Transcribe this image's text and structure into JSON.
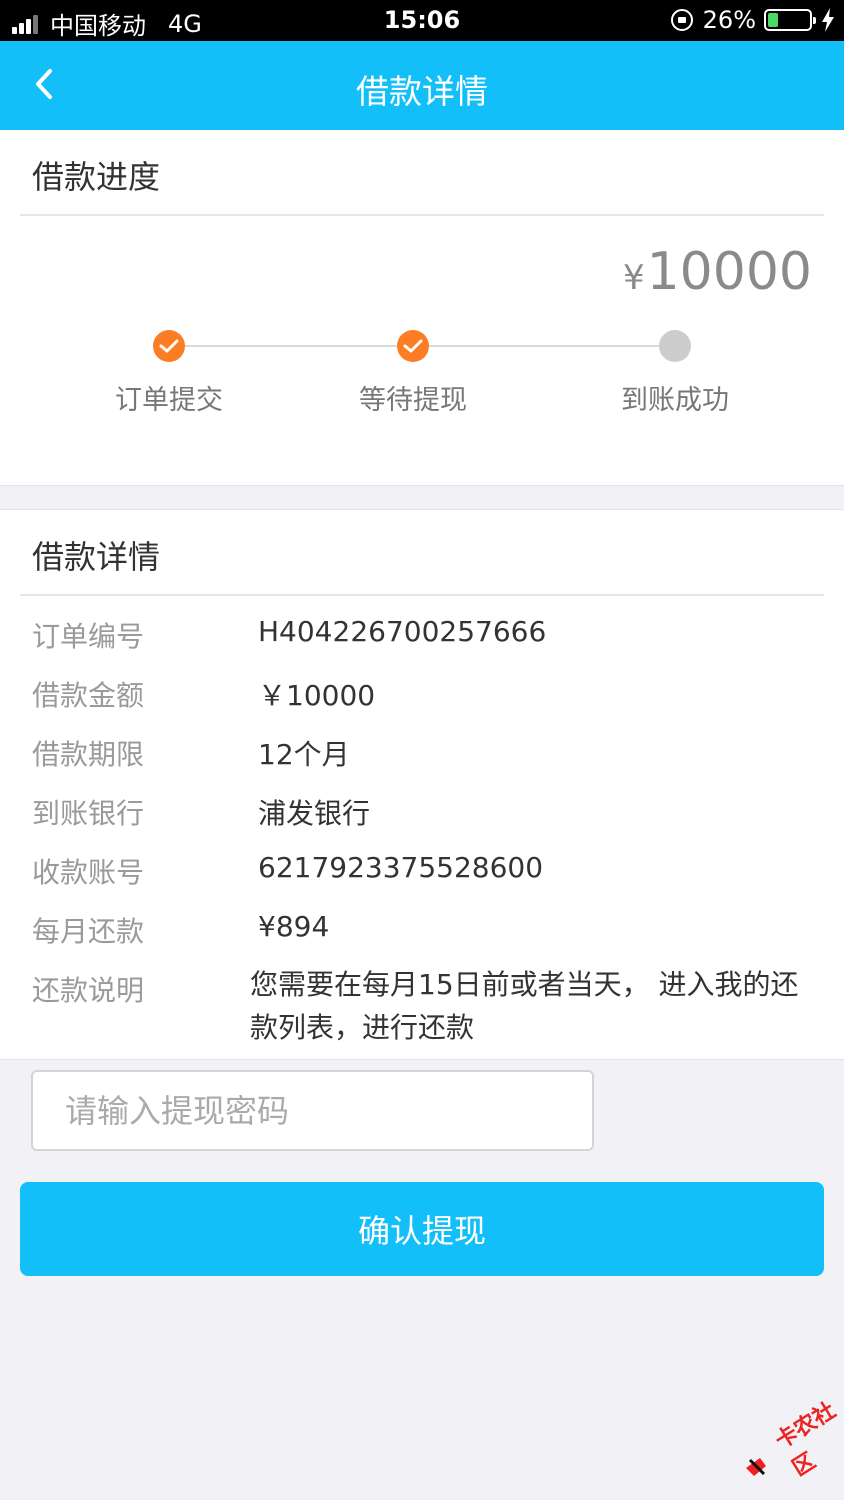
{
  "status_bar": {
    "carrier": "中国移动",
    "network": "4G",
    "time": "15:06",
    "battery": "26%",
    "battery_level": 0.26
  },
  "nav": {
    "title": "借款详情",
    "back_icon": "chevron-left-icon"
  },
  "progress": {
    "title": "借款进度",
    "currency": "¥",
    "amount": "10000",
    "steps": [
      {
        "label": "订单提交",
        "status": "done"
      },
      {
        "label": "等待提现",
        "status": "done"
      },
      {
        "label": "到账成功",
        "status": "pending"
      }
    ]
  },
  "details": {
    "title": "借款详情",
    "rows": [
      {
        "label": "订单编号",
        "value": "H404226700257666"
      },
      {
        "label": "借款金额",
        "value": "￥10000"
      },
      {
        "label": "借款期限",
        "value": "12个月"
      },
      {
        "label": "到账银行",
        "value": "浦发银行"
      },
      {
        "label": "收款账号",
        "value": "6217923375528600"
      },
      {
        "label": "每月还款",
        "value": "¥894"
      }
    ],
    "note_label": "还款说明",
    "note_value": "您需要在每月15日前或者当天， 进入我的还款列表，进行还款"
  },
  "form": {
    "password_placeholder": "请输入提现密码",
    "confirm_label": "确认提现"
  },
  "watermark": "卡农社区",
  "colors": {
    "primary": "#13bff9",
    "step_done": "#fc7d24",
    "step_pending": "#cdcdcd",
    "background": "#f2f2f6"
  }
}
